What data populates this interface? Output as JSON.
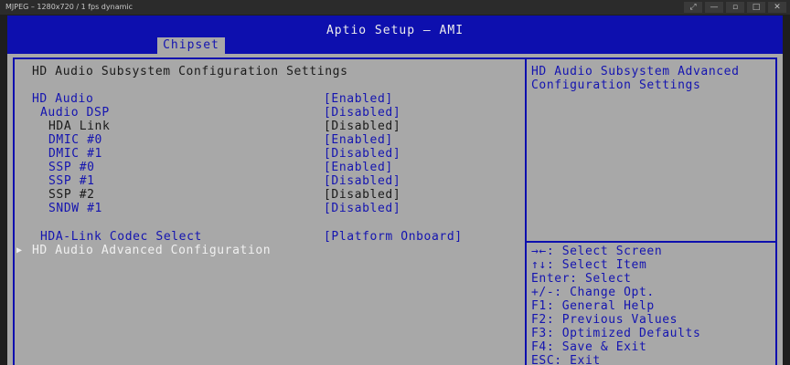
{
  "window": {
    "title": "MJPEG – 1280x720 / 1 fps dynamic",
    "controls": [
      "⤢",
      "—",
      "▫",
      "□",
      "✕"
    ]
  },
  "header": {
    "title": "Aptio Setup – AMI",
    "active_tab": "Chipset"
  },
  "main": {
    "section_title": "HD Audio Subsystem Configuration Settings",
    "items": [
      {
        "label": "HD Audio",
        "value": "[Enabled]"
      },
      {
        "label": "Audio DSP",
        "value": "[Disabled]"
      },
      {
        "label": "HDA Link",
        "value": "[Disabled]"
      },
      {
        "label": "DMIC #0",
        "value": "[Enabled]"
      },
      {
        "label": "DMIC #1",
        "value": "[Disabled]"
      },
      {
        "label": "SSP #0",
        "value": "[Enabled]"
      },
      {
        "label": "SSP #1",
        "value": "[Disabled]"
      },
      {
        "label": "SSP #2",
        "value": "[Disabled]"
      },
      {
        "label": "SNDW #1",
        "value": "[Disabled]"
      },
      {
        "label": "HDA-Link Codec Select",
        "value": "[Platform Onboard]"
      },
      {
        "label": "HD Audio Advanced Configuration",
        "value": ""
      }
    ],
    "submenu_arrow": "▶"
  },
  "help": {
    "description": [
      "HD Audio Subsystem Advanced",
      "Configuration Settings"
    ],
    "keys": [
      "→←: Select Screen",
      "↑↓: Select Item",
      "Enter: Select",
      "+/-: Change Opt.",
      "F1: General Help",
      "F2: Previous Values",
      "F3: Optimized Defaults",
      "F4: Save & Exit",
      "ESC: Exit"
    ]
  },
  "colors": {
    "header_blue": "#0d0fae",
    "panel_gray": "#a8a8a8",
    "text_blue": "#1414b0",
    "text_dark": "#1a1a1a",
    "highlight_white": "#f0f0f0"
  }
}
